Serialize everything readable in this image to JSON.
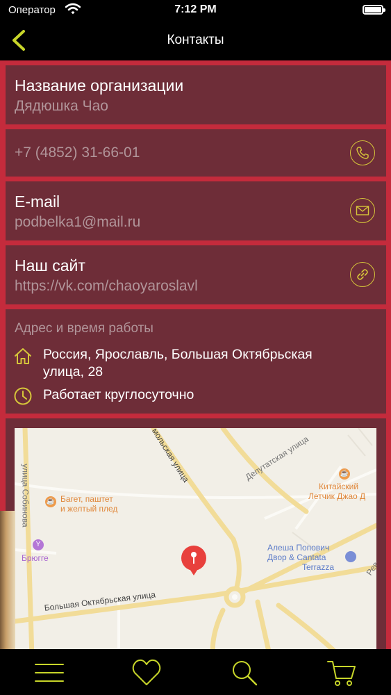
{
  "status_bar": {
    "carrier": "Оператор",
    "time": "7:12 PM"
  },
  "nav": {
    "title": "Контакты"
  },
  "org": {
    "label": "Название организации",
    "value": "Дядюшка Чао"
  },
  "phone": {
    "value": "+7 (4852) 31-66-01"
  },
  "email": {
    "label": "E-mail",
    "value": "podbelka1@mail.ru"
  },
  "site": {
    "label": "Наш сайт",
    "value": "https://vk.com/chaoyaroslavl"
  },
  "address": {
    "header": "Адрес и время работы",
    "line1": "Россия, Ярославль, Большая Октябрьская",
    "line2": "улица, 28",
    "hours": "Работает круглосуточно"
  },
  "map": {
    "street_main": "Большая Октябрьская улица",
    "street_sobinova": "улица Собинова",
    "street_top": "мольская улица",
    "street_deputat": "Депутатская улица",
    "street_rev": "Рев",
    "poi1_line1": "Багет, паштет",
    "poi1_line2": "и желтый плед",
    "poi2": "Брюгге",
    "poi3_line1": "Китайский",
    "poi3_line2": "Летчик Джао Д",
    "poi4_line1": "Алеша Попович",
    "poi4_line2": "Двор & Cantata",
    "poi4_line3": "Terrazza"
  },
  "colors": {
    "background": "#c42b3c",
    "card": "#6e2d38",
    "accent": "#c8d62a",
    "icon_gold": "#d6c63a",
    "bars": "#000000"
  },
  "tab_icons": [
    "menu-icon",
    "heart-icon",
    "search-icon",
    "cart-icon"
  ]
}
